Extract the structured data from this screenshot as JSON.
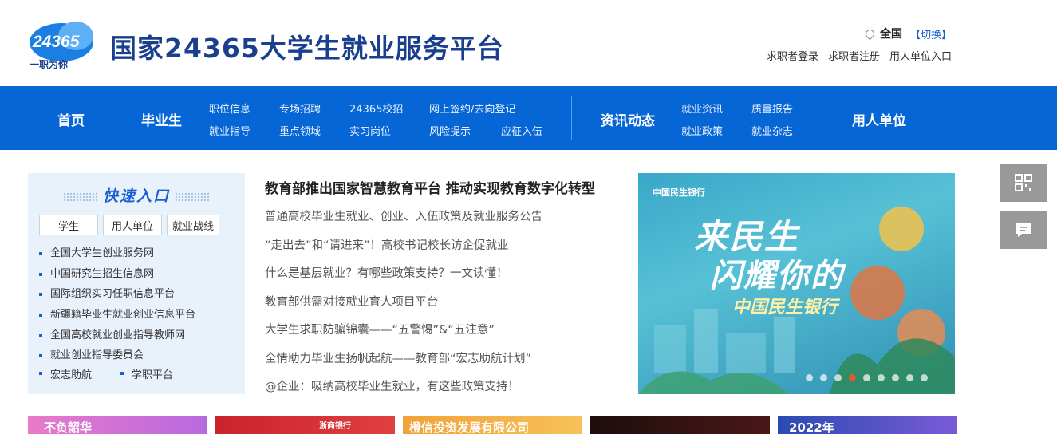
{
  "header": {
    "logo_text": "24365",
    "logo_tagline": "一职为你",
    "site_title": "国家24365大学生就业服务平台",
    "location": {
      "region": "全国",
      "switch_label": "【切换】"
    },
    "links": [
      "求职者登录",
      "求职者注册",
      "用人单位入口"
    ]
  },
  "nav": {
    "home": "首页",
    "graduates": "毕业生",
    "graduates_sub": [
      "职位信息",
      "专场招聘",
      "24365校招",
      "网上签约/去向登记",
      "就业指导",
      "重点领域",
      "实习岗位",
      "风险提示",
      "应征入伍"
    ],
    "news": "资讯动态",
    "news_sub": [
      "就业资讯",
      "质量报告",
      "就业政策",
      "就业杂志"
    ],
    "employer": "用人单位"
  },
  "quick_entry": {
    "title": "快速入口",
    "tabs": [
      "学生",
      "用人单位",
      "就业战线"
    ],
    "links": [
      "全国大学生创业服务网",
      "中国研究生招生信息网",
      "国际组织实习任职信息平台",
      "新疆籍毕业生就业创业信息平台",
      "全国高校就业创业指导教师网",
      "就业创业指导委员会"
    ],
    "last_row": [
      "宏志助航",
      "学职平台"
    ]
  },
  "news": {
    "headline": "教育部推出国家智慧教育平台 推动实现教育数字化转型",
    "items": [
      "普通高校毕业生就业、创业、入伍政策及就业服务公告",
      "“走出去”和“请进来”！高校书记校长访企促就业",
      "什么是基层就业？有哪些政策支持？一文读懂！",
      "教育部供需对接就业育人项目平台",
      "大学生求职防骗锦囊——“五警惕”&“五注意”",
      "全情助力毕业生扬帆起航——教育部“宏志助航计划”",
      "@企业：吸纳高校毕业生就业，有这些政策支持！"
    ]
  },
  "banner": {
    "bank": "中国民生银行",
    "line1": "来民生",
    "line2": "闪耀你的",
    "line3": "中国民生银行",
    "slide_count": 9,
    "active_slide": 4
  },
  "promos": [
    "不负韶华",
    "浙商银行",
    "橙信投资发展有限公司",
    "",
    "2022年"
  ],
  "colors": {
    "nav": "#0766d6",
    "title": "#1b3f8f",
    "accent": "#1a5fd0"
  }
}
